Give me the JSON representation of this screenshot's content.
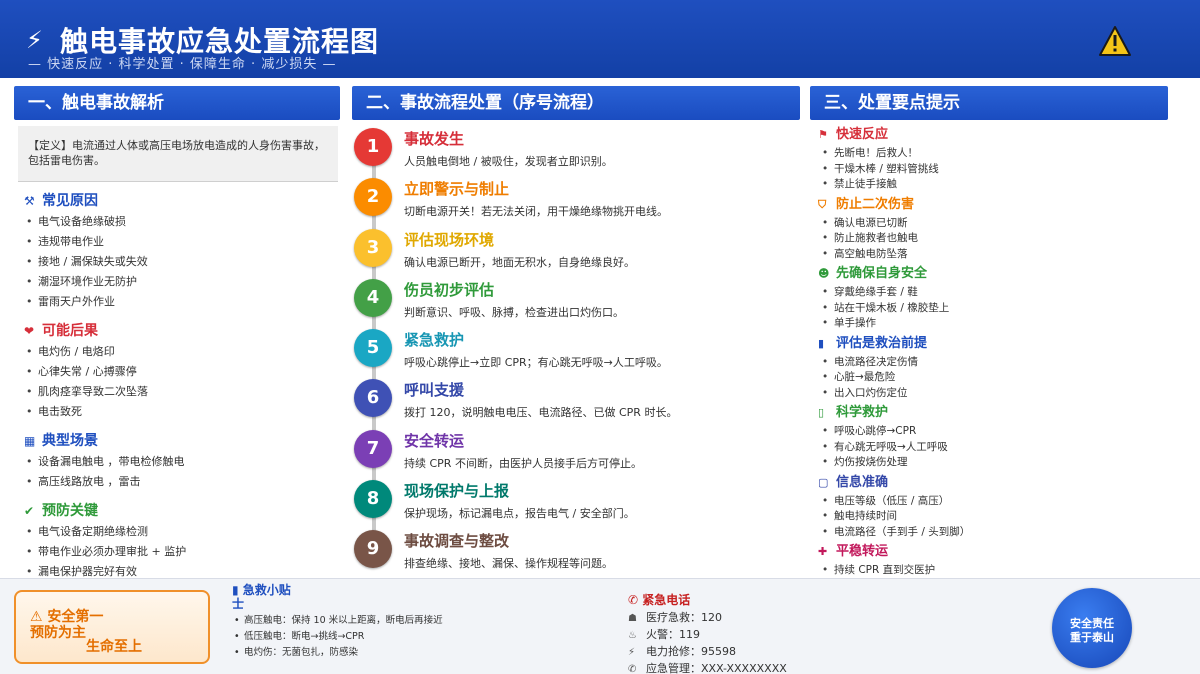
{
  "header": {
    "title": "触电事故应急处置流程图",
    "subtitle": "— 快速反应 · 科学处置 · 保障生命 · 减少损失 —",
    "bolt_icon": "⚡"
  },
  "sections": {
    "left": "一、触电事故解析",
    "center": "二、事故流程处置（序号流程）",
    "right": "三、处置要点提示"
  },
  "definition": "【定义】电流通过人体或高压电场放电造成的人身伤害事故，包括雷电伤害。",
  "left_categories": [
    {
      "title": "常见原因",
      "icon": "⚒",
      "color": "#1f4fbf",
      "items": [
        "电气设备绝缘破损",
        "违规带电作业",
        "接地 / 漏保缺失或失效",
        "潮湿环境作业无防护",
        "雷雨天户外作业"
      ]
    },
    {
      "title": "可能后果",
      "icon": "❤",
      "color": "#d62f3a",
      "items": [
        "电灼伤 / 电烙印",
        "心律失常 / 心搏骤停",
        "肌肉痉挛导致二次坠落",
        "电击致死"
      ]
    },
    {
      "title": "典型场景",
      "icon": "▦",
      "color": "#1f4fbf",
      "items": [
        "设备漏电触电 ，带电检修触电",
        "高压线路放电 ，雷击"
      ]
    },
    {
      "title": "预防关键",
      "icon": "✔",
      "color": "#2f9a3a",
      "items": [
        "电气设备定期绝缘检测",
        "带电作业必须办理审批 + 监护",
        "漏电保护器完好有效"
      ]
    }
  ],
  "steps": [
    {
      "num": "1",
      "title": "事故发生",
      "desc": "人员触电倒地 / 被吸住，发现者立即识别。",
      "color": "#e53935",
      "title_color": "#d62f3a"
    },
    {
      "num": "2",
      "title": "立即警示与制止",
      "desc": "切断电源开关！若无法关闭，用干燥绝缘物挑开电线。",
      "color": "#fb8c00",
      "title_color": "#ef7d00"
    },
    {
      "num": "3",
      "title": "评估现场环境",
      "desc": "确认电源已断开，地面无积水，自身绝缘良好。",
      "color": "#fbc02d",
      "title_color": "#e0a800"
    },
    {
      "num": "4",
      "title": "伤员初步评估",
      "desc": "判断意识、呼吸、脉搏，检查进出口灼伤口。",
      "color": "#43a047",
      "title_color": "#2f9a3a"
    },
    {
      "num": "5",
      "title": "紧急救护",
      "desc": "呼吸心跳停止→立即 CPR；有心跳无呼吸→人工呼吸。",
      "color": "#1aa7c4",
      "title_color": "#1796b3"
    },
    {
      "num": "6",
      "title": "呼叫支援",
      "desc": "拨打 120，说明触电电压、电流路径、已做 CPR 时长。",
      "color": "#3f51b5",
      "title_color": "#3347a8"
    },
    {
      "num": "7",
      "title": "安全转运",
      "desc": "持续 CPR 不间断，由医护人员接手后方可停止。",
      "color": "#7b3fb5",
      "title_color": "#6f34a8"
    },
    {
      "num": "8",
      "title": "现场保护与上报",
      "desc": "保护现场，标记漏电点，报告电气 / 安全部门。",
      "color": "#00897b",
      "title_color": "#00796b"
    },
    {
      "num": "9",
      "title": "事故调查与整改",
      "desc": "排查绝缘、接地、漏保、操作规程等问题。",
      "color": "#795548",
      "title_color": "#6d4c41"
    }
  ],
  "tips": [
    {
      "title": "快速反应",
      "icon": "⚑",
      "color": "#d62f3a",
      "items": [
        "先断电！后救人！",
        "干燥木棒 / 塑料管挑线",
        "禁止徒手接触"
      ]
    },
    {
      "title": "防止二次伤害",
      "icon": "⛉",
      "color": "#ef7d00",
      "items": [
        "确认电源已切断",
        "防止施救者也触电",
        "高空触电防坠落"
      ]
    },
    {
      "title": "先确保自身安全",
      "icon": "☻",
      "color": "#2f9a3a",
      "items": [
        "穿戴绝缘手套 / 鞋",
        "站在干燥木板 / 橡胶垫上",
        "单手操作"
      ]
    },
    {
      "title": "评估是救治前提",
      "icon": "▮",
      "color": "#1f4fbf",
      "items": [
        "电流路径决定伤情",
        "心脏→最危险",
        "出入口灼伤定位"
      ]
    },
    {
      "title": "科学救护",
      "icon": "▯",
      "color": "#2f9a3a",
      "items": [
        "呼吸心跳停→CPR",
        "有心跳无呼吸→人工呼吸",
        "灼伤按烧伤处理"
      ]
    },
    {
      "title": "信息准确",
      "icon": "▢",
      "color": "#3347a8",
      "items": [
        "电压等级（低压 / 高压）",
        "触电持续时间",
        "电流路径（手到手 / 头到脚）"
      ]
    },
    {
      "title": "平稳转运",
      "icon": "✚",
      "color": "#c2185b",
      "items": [
        "持续 CPR 直到交医护"
      ]
    }
  ],
  "footer": {
    "safety": {
      "l1": "⚠ 安全第一",
      "l2": "预防为主",
      "l3": "生命至上"
    },
    "first_aid": {
      "title": "▮ 急救小贴士",
      "items": [
        "高压触电：保持 10 米以上距离，断电后再接近",
        "低压触电：断电→挑线→CPR",
        "电灼伤：无菌包扎，防感染"
      ]
    },
    "phones": {
      "title": "✆ 紧急电话",
      "rows": [
        {
          "icon": "☗",
          "text": "医疗急救：120"
        },
        {
          "icon": "♨",
          "text": "火警：119"
        },
        {
          "icon": "⚡",
          "text": "电力抢修：95598"
        },
        {
          "icon": "✆",
          "text": "应急管理：XXX-XXXXXXXX"
        }
      ]
    },
    "seal": {
      "s1": "安全责任",
      "s2": "重于泰山"
    }
  }
}
